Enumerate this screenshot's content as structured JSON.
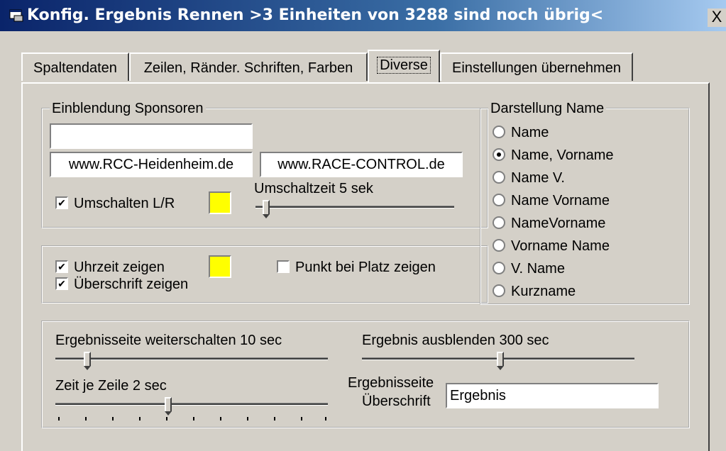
{
  "window": {
    "title": "Konfig. Ergebnis Rennen >3 Einheiten von 3288 sind noch übrig<",
    "close_label": "X"
  },
  "tabs": [
    {
      "label": "Spaltendaten"
    },
    {
      "label": "Zeilen, Ränder. Schriften, Farben"
    },
    {
      "label": "Diverse",
      "active": true
    },
    {
      "label": "Einstellungen übernehmen"
    }
  ],
  "sponsoren": {
    "legend": "Einblendung Sponsoren",
    "field_top": "",
    "field_left": "www.RCC-Heidenheim.de",
    "field_right": "www.RACE-CONTROL.de",
    "umschalten_label": "Umschalten L/R",
    "umschalten_checked": true,
    "umschaltzeit_label": "Umschaltzeit 5 sek",
    "umschaltzeit_value": 5,
    "color": "#ffff00"
  },
  "anzeige": {
    "uhrzeit_label": "Uhrzeit zeigen",
    "uhrzeit_checked": true,
    "ueberschrift_label": "Überschrift zeigen",
    "ueberschrift_checked": true,
    "punkt_label": "Punkt bei Platz zeigen",
    "punkt_checked": false,
    "color": "#ffff00"
  },
  "darstellung": {
    "legend": "Darstellung Name",
    "options": [
      {
        "label": "Name",
        "selected": false
      },
      {
        "label": "Name, Vorname",
        "selected": true
      },
      {
        "label": "Name V.",
        "selected": false
      },
      {
        "label": "Name Vorname",
        "selected": false
      },
      {
        "label": "NameVorname",
        "selected": false
      },
      {
        "label": "Vorname Name",
        "selected": false
      },
      {
        "label": "V. Name",
        "selected": false
      },
      {
        "label": "Kurzname",
        "selected": false
      }
    ]
  },
  "timing": {
    "weiterschalten_label": "Ergebnisseite weiterschalten  10 sec",
    "weiterschalten_value": 10,
    "ausblenden_label": "Ergebnis ausblenden   300 sec",
    "ausblenden_value": 300,
    "zeile_label": "Zeit je Zeile  2 sec",
    "zeile_value": 2,
    "ueberschrift_label_1": "Ergebnisseite",
    "ueberschrift_label_2": "Überschrift",
    "ueberschrift_value": "Ergebnis"
  }
}
